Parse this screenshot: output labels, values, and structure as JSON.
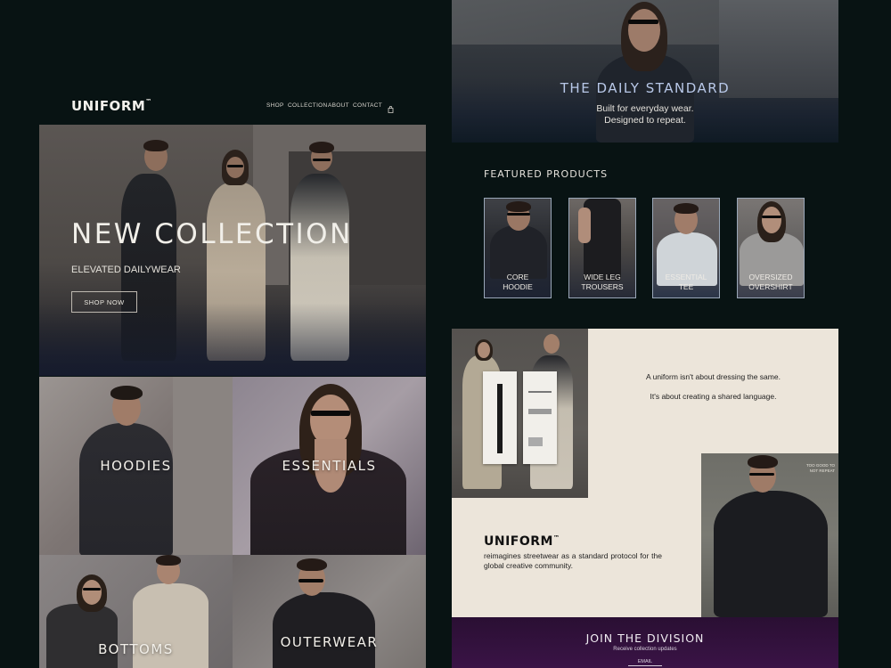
{
  "brand": {
    "logo": "UNIFORM",
    "trademark": "™"
  },
  "nav": {
    "shop": "SHOP",
    "collection": "COLLECTION",
    "about": "ABOUT",
    "contact": "CONTACT"
  },
  "hero": {
    "title": "NEW COLLECTION",
    "subtitle": "ELEVATED DAILYWEAR",
    "cta": "SHOP NOW"
  },
  "categories": [
    "HOODIES",
    "ESSENTIALS",
    "BOTTOMS",
    "OUTERWEAR"
  ],
  "banner": {
    "title": "THE DAILY STANDARD",
    "line1": "Built for everyday wear.",
    "line2": "Designed to repeat."
  },
  "featured": {
    "title": "FEATURED PRODUCTS",
    "products": [
      {
        "line1": "CORE",
        "line2": "HOODIE"
      },
      {
        "line1": "WIDE LEG",
        "line2": "TROUSERS"
      },
      {
        "line1": "ESSENTIAL",
        "line2": "TEE"
      },
      {
        "line1": "OVERSIZED",
        "line2": "OVERSHIRT"
      }
    ]
  },
  "about": {
    "quote1": "A uniform isn't about dressing the same.",
    "quote2": "It's about creating a shared language.",
    "logo": "UNIFORM",
    "text": "reimagines streetwear as a standard protocol for the global creative community.",
    "tag_text": "TOO GOOD TO NOT REPEAT"
  },
  "join": {
    "title": "JOIN THE DIVISION",
    "subtitle": "Receive collection updates",
    "email_label": "EMAIL"
  },
  "colors": {
    "background": "#081313",
    "accent": "#b8c8e8",
    "panel": "#ece5da",
    "join": "#2a0f33"
  }
}
